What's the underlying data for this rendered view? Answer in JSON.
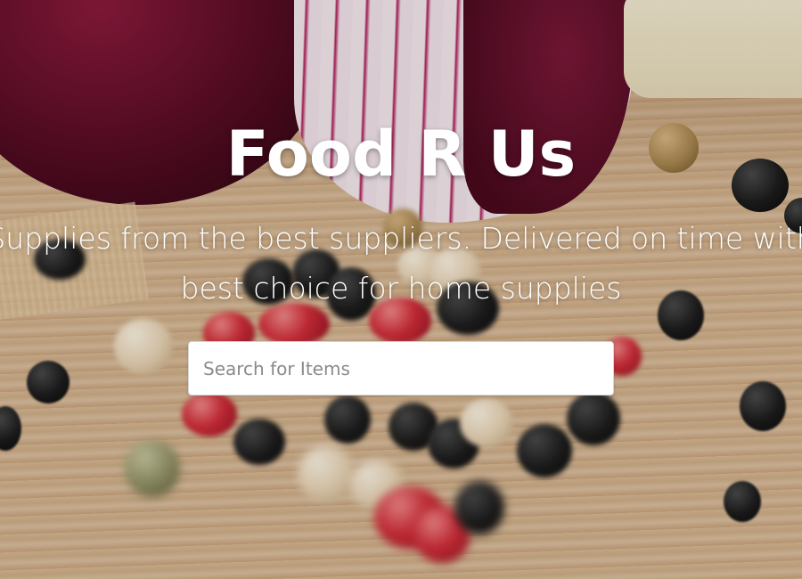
{
  "hero": {
    "title": "Food R Us",
    "subtitle_line1": "Supplies from the best suppliers. Delivered on time with",
    "subtitle_line2": "best choice for home supplies"
  },
  "search": {
    "placeholder": "Search for Items",
    "value": ""
  },
  "background": {
    "subject": "red onion, garlic and mixed peppercorns on wooden cutting board",
    "colors": {
      "wood": "#d2b08a",
      "onion": "#5e0e27",
      "text": "#ffffff",
      "input_bg": "#ffffff",
      "placeholder": "#8a8a8a"
    }
  }
}
